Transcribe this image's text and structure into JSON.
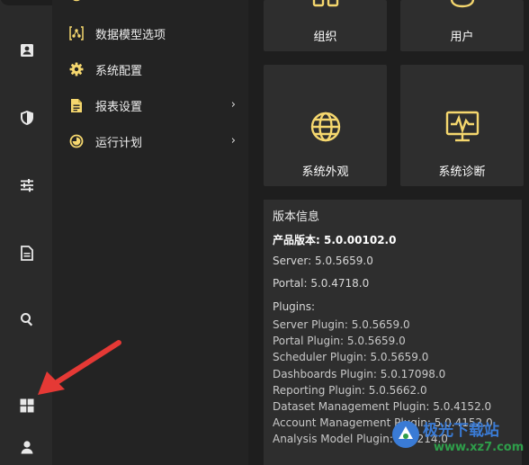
{
  "menu": {
    "items": [
      {
        "label": "数据模型选项",
        "icon": "data-model-icon",
        "has_submenu": false
      },
      {
        "label": "系统配置",
        "icon": "gear-icon",
        "has_submenu": false
      },
      {
        "label": "报表设置",
        "icon": "report-icon",
        "has_submenu": true
      },
      {
        "label": "运行计划",
        "icon": "schedule-icon",
        "has_submenu": true
      }
    ],
    "chevron": "›"
  },
  "tiles": {
    "org": {
      "label": "组织",
      "icon": "organization-icon"
    },
    "user": {
      "label": "用户",
      "icon": "user-icon"
    },
    "appearance": {
      "label": "系统外观",
      "icon": "globe-icon"
    },
    "diagnostics": {
      "label": "系统诊断",
      "icon": "monitor-pulse-icon"
    }
  },
  "version": {
    "title": "版本信息",
    "product": "产品版本: 5.0.00102.0",
    "server": "Server: 5.0.5659.0",
    "portal": "Portal: 5.0.4718.0",
    "plugins_label": "Plugins:",
    "plugins": [
      "Server Plugin: 5.0.5659.0",
      "Portal Plugin: 5.0.5659.0",
      "Scheduler Plugin: 5.0.5659.0",
      "Dashboards Plugin: 5.0.17098.0",
      "Reporting Plugin: 5.0.5662.0",
      "Dataset Management Plugin: 5.0.4152.0",
      "Account Management Plugin: 5.0.4152.0",
      "Analysis Model Plugin: 5.0.214.0"
    ]
  },
  "rail": [
    "contact-card-icon",
    "shield-icon",
    "sliders-icon",
    "document-icon",
    "search-icon",
    "grid-icon",
    "user-icon"
  ],
  "watermark": {
    "cn": "极光下载站",
    "url": "www.xz7.com"
  },
  "colors": {
    "accent": "#f5d76e",
    "arrow": "#e53935"
  }
}
